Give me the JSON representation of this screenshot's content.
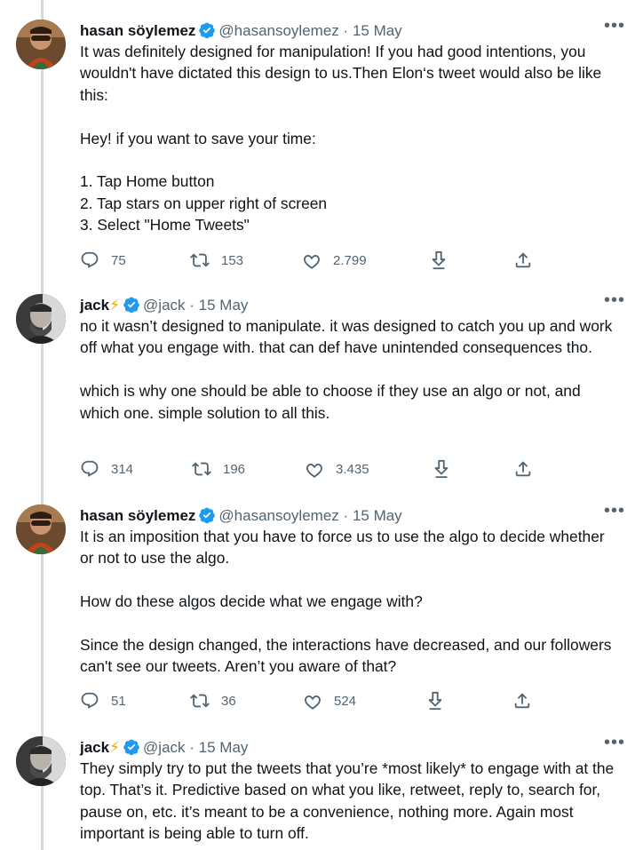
{
  "tweets": [
    {
      "name": "hasan söylemez",
      "handle": "@hasansoylemez",
      "date": "15 May",
      "text": "It was definitely designed for manipulation! If you had good intentions, you wouldn't have dictated this design to us.Then Elon‘s tweet would also be like this:\n\nHey! if you want to save your time:\n\n1. Tap Home button\n2. Tap stars on upper right of screen\n3. Select \"Home Tweets\"",
      "replies": "75",
      "retweets": "153",
      "likes": "2.799"
    },
    {
      "name": "jack",
      "name_emoji": "⚡",
      "handle": "@jack",
      "date": "15 May",
      "text": "no it wasn’t designed to manipulate. it was designed to catch you up and work off what you engage with. that can def have unintended consequences tho.\n\nwhich is why one should be able to choose if they use an algo or not, and which one. simple solution to all this.",
      "replies": "314",
      "retweets": "196",
      "likes": "3.435"
    },
    {
      "name": "hasan söylemez",
      "handle": "@hasansoylemez",
      "date": "15 May",
      "text": "It is an imposition that you have to force us to use the algo to decide whether or not to use the algo.\n\nHow do these algos decide what we engage with?\n\nSince the design changed, the interactions have decreased, and our followers can't see our tweets. Aren’t you aware of that?",
      "replies": "51",
      "retweets": "36",
      "likes": "524"
    },
    {
      "name": "jack",
      "name_emoji": "⚡",
      "handle": "@jack",
      "date": "15 May",
      "text": "They simply try to put the tweets that you’re *most likely* to engage with at the top. That’s it. Predictive based on what you like, retweet, reply to, search for, pause on, etc. it’s meant to be a convenience, nothing more. Again most important is being able to turn off."
    }
  ],
  "ui": {
    "more_label": "•••",
    "separator": "·"
  },
  "icons": [
    "verified-badge-icon",
    "reply-icon",
    "retweet-icon",
    "like-icon",
    "download-icon",
    "share-icon",
    "more-icon"
  ],
  "colors": {
    "verified": "#1d9bf0",
    "muted": "#536471",
    "thread_line": "#cfd9de",
    "text": "#0f1419"
  }
}
